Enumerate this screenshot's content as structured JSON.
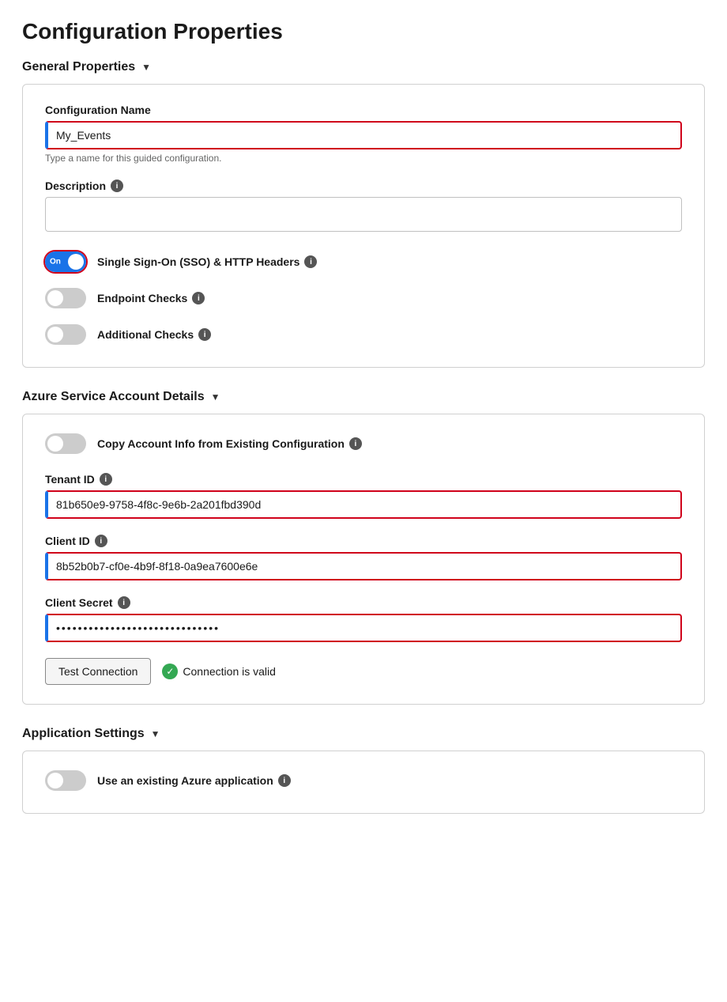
{
  "page": {
    "title": "Configuration Properties"
  },
  "general_section": {
    "header": "General Properties",
    "chevron": "▼",
    "config_name_label": "Configuration Name",
    "config_name_value": "My_Events",
    "config_name_hint": "Type a name for this guided configuration.",
    "description_label": "Description",
    "sso_label": "Single Sign-On (SSO) & HTTP Headers",
    "sso_on": true,
    "sso_on_text": "On",
    "endpoint_label": "Endpoint Checks",
    "endpoint_on": false,
    "additional_label": "Additional Checks",
    "additional_on": false
  },
  "azure_section": {
    "header": "Azure Service Account Details",
    "chevron": "▼",
    "copy_label": "Copy Account Info from Existing Configuration",
    "copy_on": false,
    "tenant_id_label": "Tenant ID",
    "tenant_id_value": "81b650e9-9758-4f8c-9e6b-2a201fbd390d",
    "client_id_label": "Client ID",
    "client_id_value": "8b52b0b7-cf0e-4b9f-8f18-0a9ea7600e6e",
    "client_secret_label": "Client Secret",
    "client_secret_value": "••••••••••••••••••••••••••••••",
    "test_button_label": "Test Connection",
    "connection_status": "Connection is valid"
  },
  "app_section": {
    "header": "Application Settings",
    "chevron": "▼",
    "use_existing_label": "Use an existing Azure application",
    "use_existing_on": false
  },
  "icons": {
    "info": "i",
    "check": "✓"
  }
}
